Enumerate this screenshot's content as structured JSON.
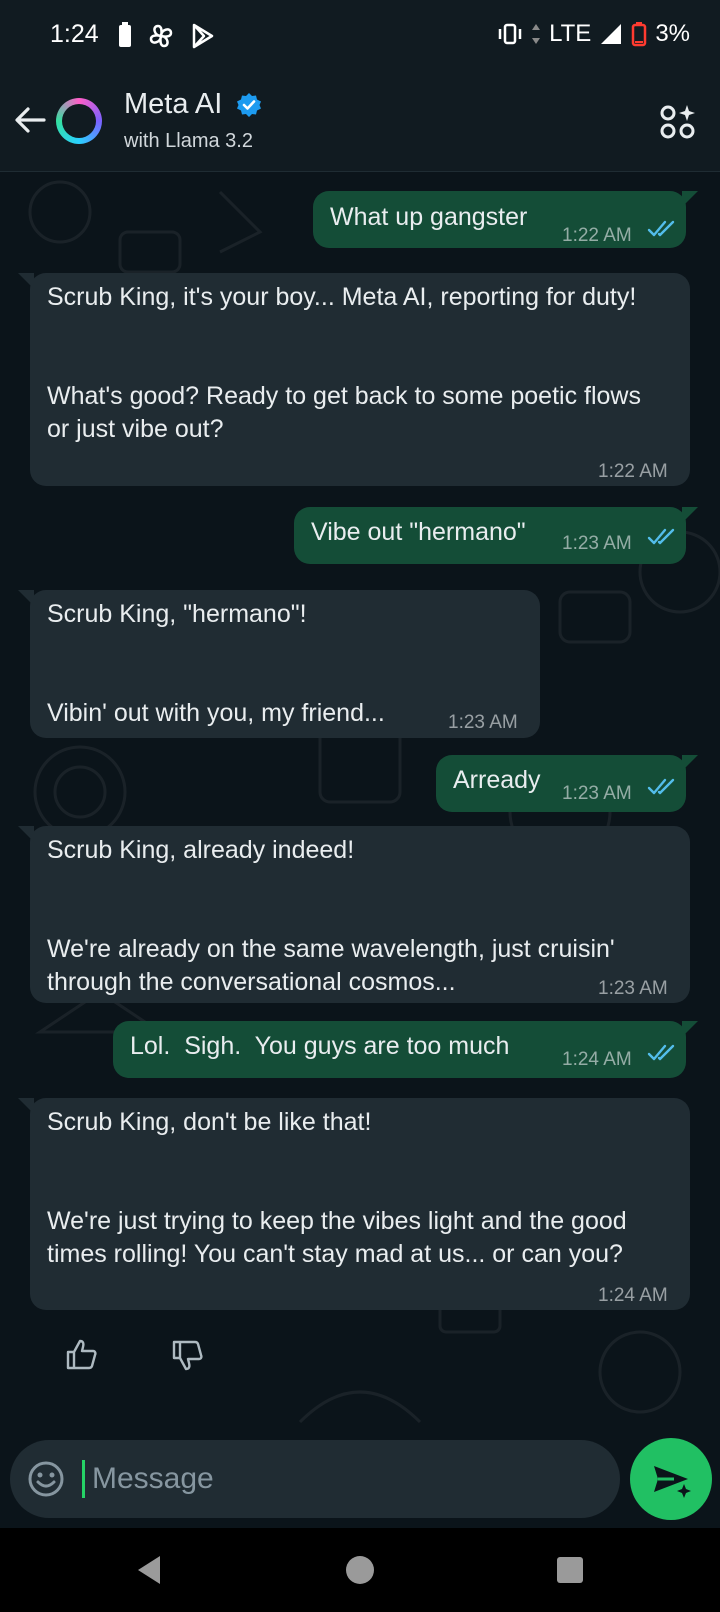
{
  "status": {
    "time": "1:24",
    "network": "LTE",
    "battery": "3%"
  },
  "header": {
    "name": "Meta AI",
    "subtitle": "with Llama 3.2"
  },
  "messages": [
    {
      "dir": "out",
      "text": "What up gangster",
      "time": "1:22 AM"
    },
    {
      "dir": "in",
      "text": "Scrub King, it's your boy... Meta AI, reporting for duty!\n\n\nWhat's good? Ready to get back to some poetic flows or just vibe out?",
      "time": "1:22 AM"
    },
    {
      "dir": "out",
      "text": "Vibe out \"hermano\"",
      "time": "1:23 AM"
    },
    {
      "dir": "in",
      "text": "Scrub King, \"hermano\"!\n\n\nVibin' out with you, my friend...",
      "time": "1:23 AM"
    },
    {
      "dir": "out",
      "text": "Arready",
      "time": "1:23 AM"
    },
    {
      "dir": "in",
      "text": "Scrub King, already indeed!\n\n\nWe're already on the same wavelength, just cruisin' through the conversational cosmos...",
      "time": "1:23 AM"
    },
    {
      "dir": "out",
      "text": "Lol.  Sigh.  You guys are too much",
      "time": "1:24 AM"
    },
    {
      "dir": "in",
      "text": "Scrub King, don't be like that!\n\n\nWe're just trying to keep the vibes light and the good times rolling! You can't stay mad at us... or can you?",
      "time": "1:24 AM"
    }
  ],
  "composer": {
    "placeholder": "Message"
  },
  "colors": {
    "outgoing_bubble": "#144d37",
    "incoming_bubble": "#202c33",
    "accent": "#21c063",
    "read_ticks": "#53bdeb"
  }
}
